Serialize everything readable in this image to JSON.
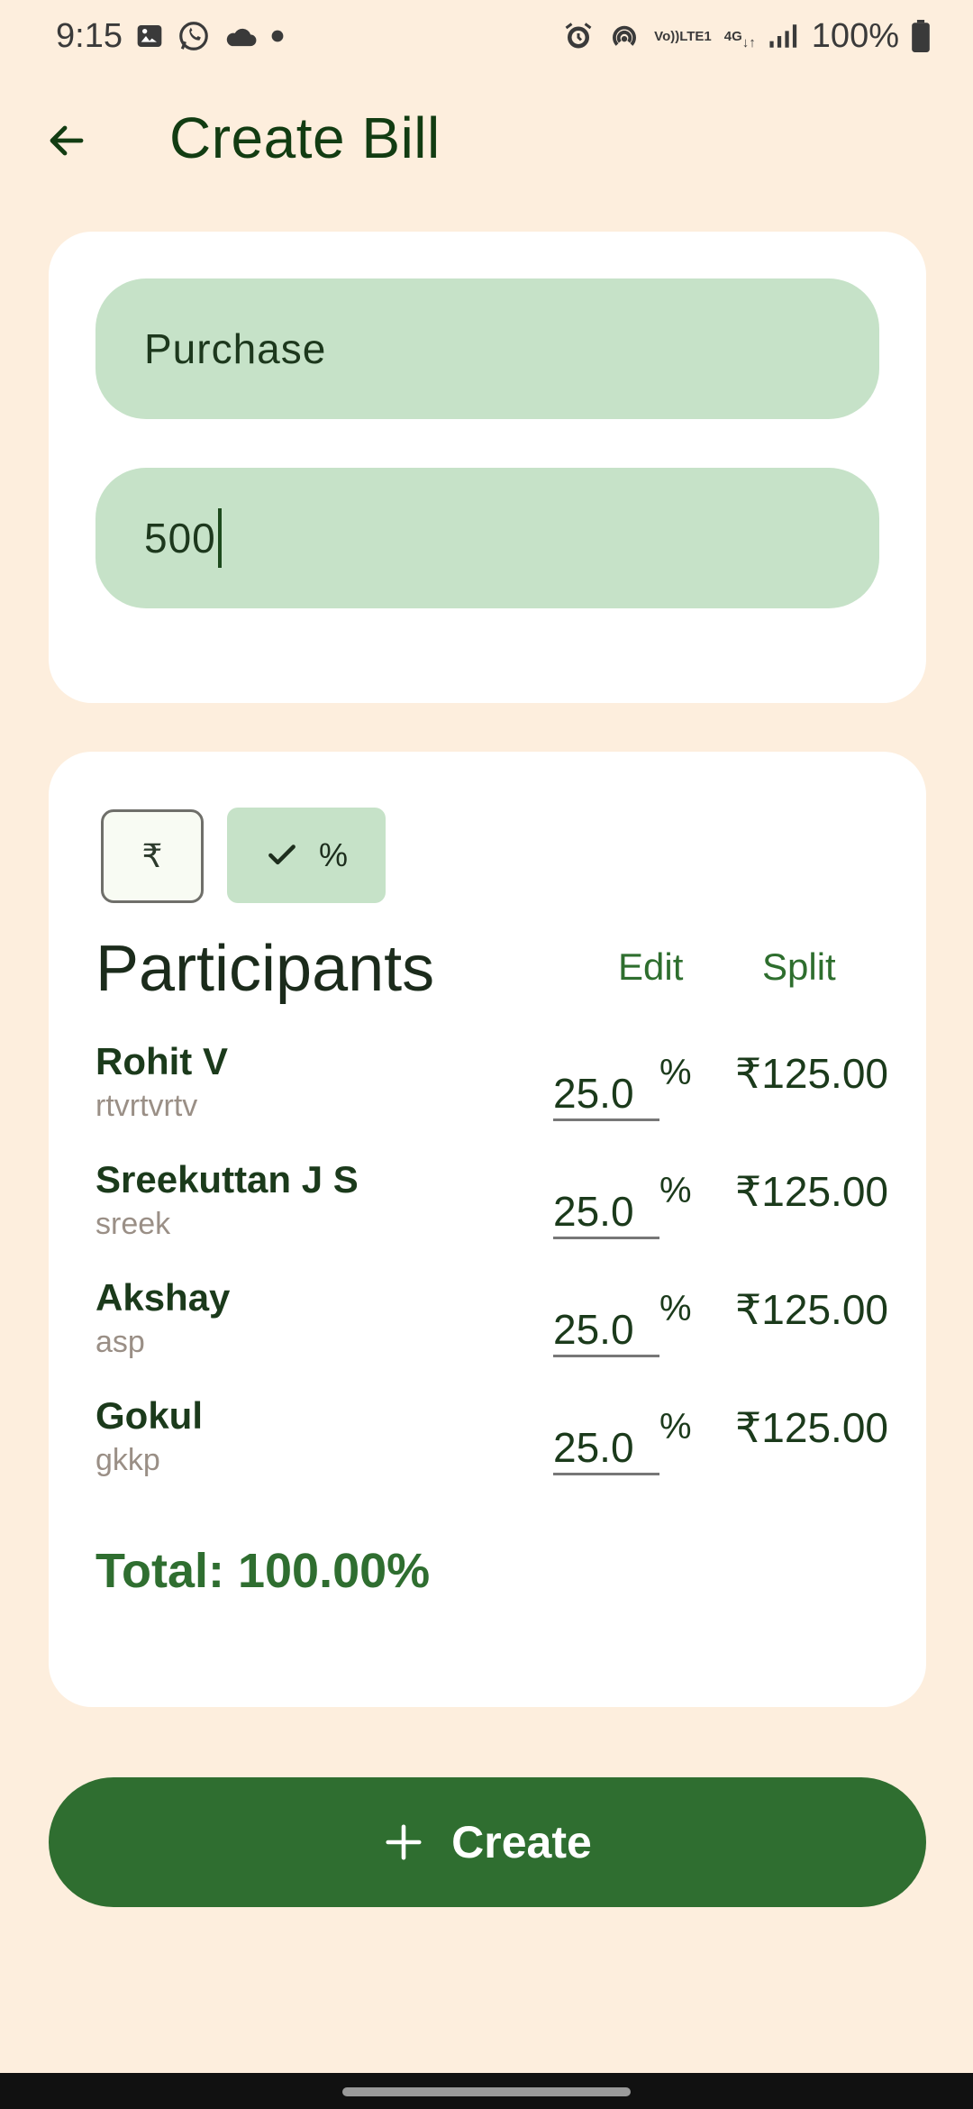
{
  "status_bar": {
    "time": "9:15",
    "battery": "100%",
    "network": "4G",
    "lte_top": "Vo))",
    "lte_bottom": "LTE1",
    "left_icons": [
      "gallery-icon",
      "whatsapp-icon",
      "cloud-icon",
      "dot-icon"
    ],
    "right_icons": [
      "alarm-icon",
      "hotspot-icon",
      "volte-icon",
      "4g-icon",
      "signal-icon",
      "battery-icon"
    ]
  },
  "app_bar": {
    "back_icon": "arrow-left-icon",
    "title": "Create Bill"
  },
  "inputs": {
    "title_value": "Purchase",
    "amount_value": "500"
  },
  "split_mode": {
    "rupee_label": "₹",
    "percent_label": "%",
    "selected": "percent"
  },
  "participants": {
    "heading": "Participants",
    "edit_label": "Edit",
    "split_label": "Split",
    "rows": [
      {
        "name": "Rohit V",
        "username": "rtvrtvrtv",
        "percent": "25.0",
        "percent_sign": "%",
        "amount": "₹125.00"
      },
      {
        "name": "Sreekuttan J S",
        "username": "sreek",
        "percent": "25.0",
        "percent_sign": "%",
        "amount": "₹125.00"
      },
      {
        "name": "Akshay",
        "username": "asp",
        "percent": "25.0",
        "percent_sign": "%",
        "amount": "₹125.00"
      },
      {
        "name": "Gokul",
        "username": "gkkp",
        "percent": "25.0",
        "percent_sign": "%",
        "amount": "₹125.00"
      }
    ],
    "total": "Total: 100.00%"
  },
  "create_button": {
    "label": "Create",
    "icon": "plus-icon"
  },
  "colors": {
    "background": "#fdeedd",
    "field": "#c6e2c8",
    "primary": "#2f6e30",
    "text": "#1b3a1b"
  }
}
